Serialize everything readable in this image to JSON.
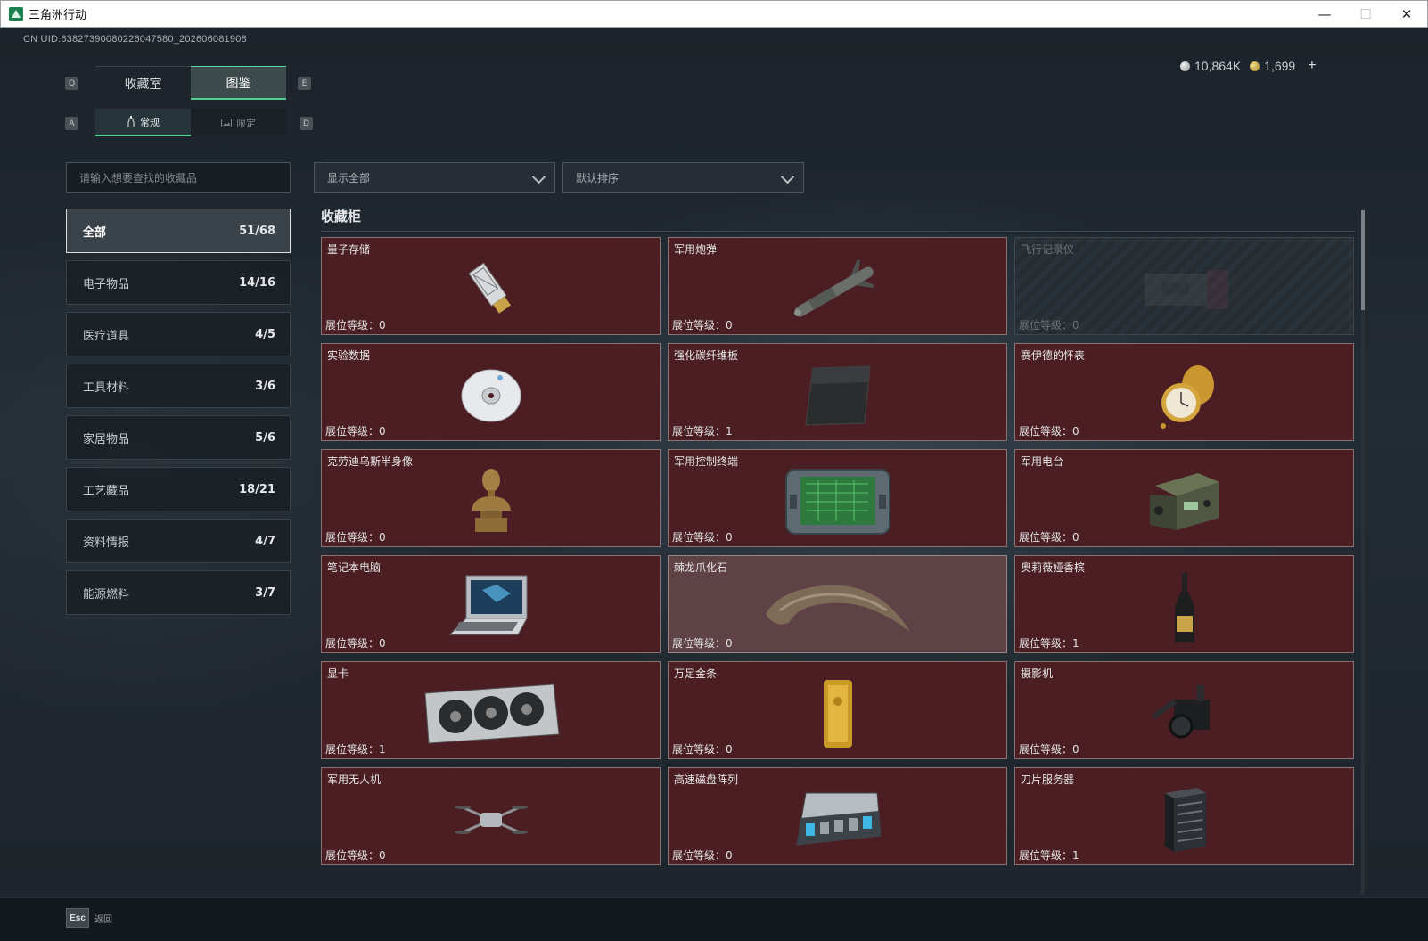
{
  "window": {
    "title": "三角洲行动",
    "minimize": "—",
    "maximize": "☐",
    "close": "✕"
  },
  "header": {
    "uid": "CN UID:63827390080226047580_202606081908",
    "silver": "10,864K",
    "gold": "1,699",
    "plus": "+"
  },
  "keys": {
    "q": "Q",
    "e": "E",
    "a": "A",
    "d": "D"
  },
  "tabs": [
    {
      "label": "收藏室",
      "active": false
    },
    {
      "label": "图鉴",
      "active": true
    }
  ],
  "subtabs": [
    {
      "label": "常规",
      "icon": "bottle-icon",
      "active": true
    },
    {
      "label": "限定",
      "icon": "image-icon",
      "active": false
    }
  ],
  "search": {
    "placeholder": "请输入想要查找的收藏品",
    "value": ""
  },
  "filters": {
    "display": "显示全部",
    "sort": "默认排序"
  },
  "categories": [
    {
      "label": "全部",
      "count": "51/68"
    },
    {
      "label": "电子物品",
      "count": "14/16"
    },
    {
      "label": "医疗道具",
      "count": "4/5"
    },
    {
      "label": "工具材料",
      "count": "3/6"
    },
    {
      "label": "家居物品",
      "count": "5/6"
    },
    {
      "label": "工艺藏品",
      "count": "18/21"
    },
    {
      "label": "资料情报",
      "count": "4/7"
    },
    {
      "label": "能源燃料",
      "count": "3/7"
    }
  ],
  "cabinet": {
    "title": "收藏柜",
    "items": [
      {
        "name": "量子存储",
        "level": "展位等级：0",
        "icon": "usb-drive-icon"
      },
      {
        "name": "军用炮弹",
        "level": "展位等级：0",
        "icon": "missile-icon"
      },
      {
        "name": "飞行记录仪",
        "level": "展位等级：0",
        "icon": "flight-recorder-icon",
        "locked": true
      },
      {
        "name": "实验数据",
        "level": "展位等级：0",
        "icon": "disc-icon"
      },
      {
        "name": "强化碳纤维板",
        "level": "展位等级：1",
        "icon": "carbon-plate-icon"
      },
      {
        "name": "赛伊德的怀表",
        "level": "展位等级：0",
        "icon": "pocket-watch-icon"
      },
      {
        "name": "克劳迪乌斯半身像",
        "level": "展位等级：0",
        "icon": "bust-icon"
      },
      {
        "name": "军用控制终端",
        "level": "展位等级：0",
        "icon": "control-terminal-icon"
      },
      {
        "name": "军用电台",
        "level": "展位等级：0",
        "icon": "radio-icon"
      },
      {
        "name": "笔记本电脑",
        "level": "展位等级：0",
        "icon": "laptop-icon"
      },
      {
        "name": "棘龙爪化石",
        "level": "展位等级：0",
        "icon": "claw-fossil-icon",
        "highlight": true
      },
      {
        "name": "奥莉薇娅香槟",
        "level": "展位等级：1",
        "icon": "champagne-icon"
      },
      {
        "name": "显卡",
        "level": "展位等级：1",
        "icon": "graphics-card-icon"
      },
      {
        "name": "万足金条",
        "level": "展位等级：0",
        "icon": "gold-bar-icon"
      },
      {
        "name": "摄影机",
        "level": "展位等级：0",
        "icon": "camera-icon"
      },
      {
        "name": "军用无人机",
        "level": "展位等级：0",
        "icon": "drone-icon"
      },
      {
        "name": "高速磁盘阵列",
        "level": "展位等级：0",
        "icon": "disk-array-icon"
      },
      {
        "name": "刀片服务器",
        "level": "展位等级：1",
        "icon": "blade-server-icon"
      }
    ]
  },
  "footer": {
    "esc_key": "Esc",
    "back_label": "返回"
  }
}
